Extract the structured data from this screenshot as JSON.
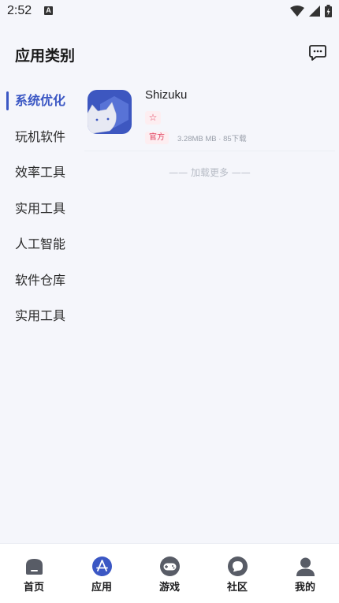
{
  "status_bar": {
    "time": "2:52",
    "a_badge": "A"
  },
  "header": {
    "title": "应用类别",
    "chat_icon": "chat-bubble-icon"
  },
  "sidebar": {
    "items": [
      {
        "label": "系统优化",
        "active": true
      },
      {
        "label": "玩机软件",
        "active": false
      },
      {
        "label": "效率工具",
        "active": false
      },
      {
        "label": "实用工具",
        "active": false
      },
      {
        "label": "人工智能",
        "active": false
      },
      {
        "label": "软件仓库",
        "active": false
      },
      {
        "label": "实用工具",
        "active": false
      }
    ]
  },
  "app_list": {
    "items": [
      {
        "name": "Shizuku",
        "favorite_icon": "☆",
        "tag": "官方",
        "meta": "3.28MB MB · 85下载"
      }
    ],
    "load_more": "—— 加载更多 ——"
  },
  "bottom_nav": {
    "items": [
      {
        "label": "首页",
        "icon": "home-icon",
        "active": false
      },
      {
        "label": "应用",
        "icon": "app-store-icon",
        "active": true
      },
      {
        "label": "游戏",
        "icon": "gamepad-icon",
        "active": false
      },
      {
        "label": "社区",
        "icon": "community-icon",
        "active": false
      },
      {
        "label": "我的",
        "icon": "profile-icon",
        "active": false
      }
    ]
  },
  "colors": {
    "accent": "#3b57c4",
    "tag": "#e0405e",
    "background": "#f5f6fb"
  }
}
